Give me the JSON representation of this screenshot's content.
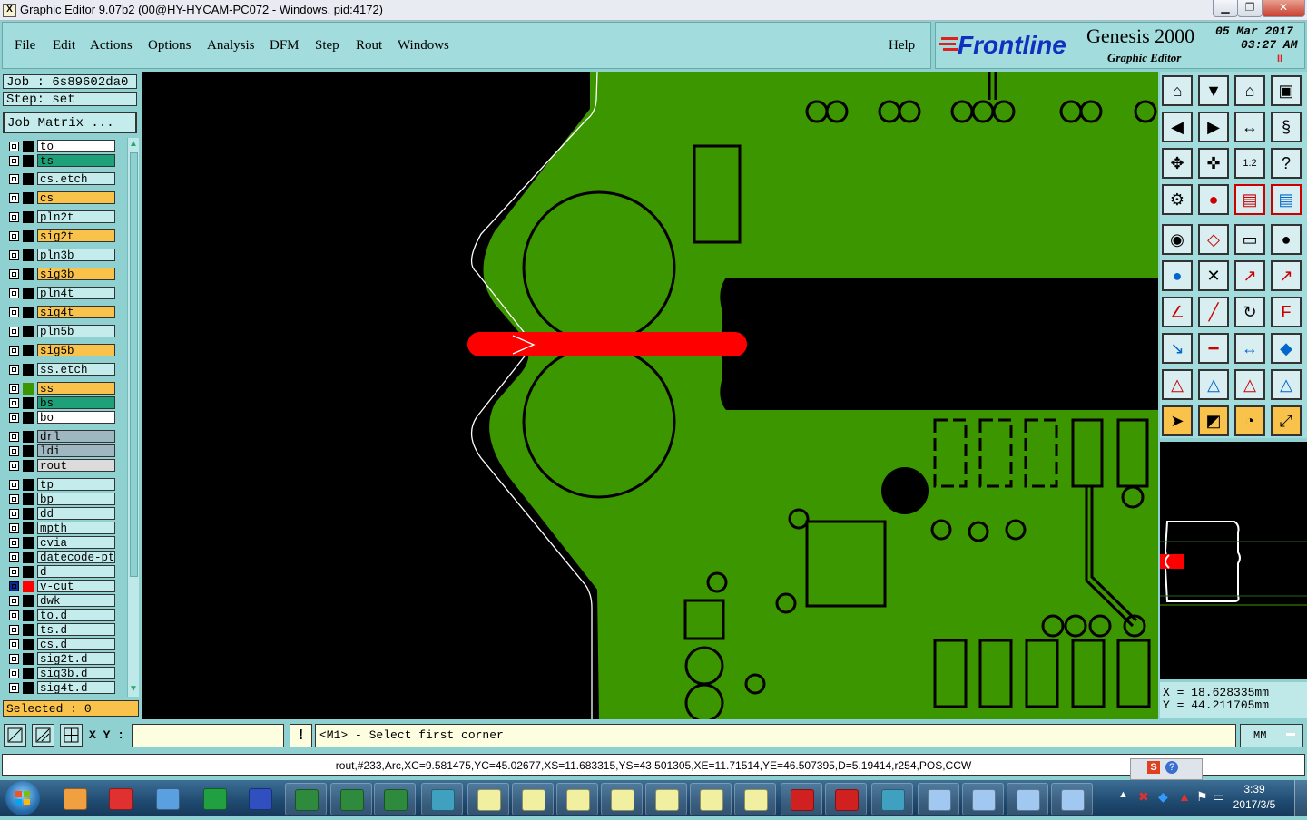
{
  "window": {
    "title": "Graphic Editor 9.07b2 (00@HY-HYCAM-PC072 - Windows, pid:4172)",
    "app_icon": "X"
  },
  "menu": [
    "File",
    "Edit",
    "Actions",
    "Options",
    "Analysis",
    "DFM",
    "Step",
    "Rout",
    "Windows"
  ],
  "help": "Help",
  "brand": {
    "logo": "Frontline",
    "product": "Genesis 2000",
    "subtitle": "Graphic Editor",
    "date": "05 Mar 2017",
    "time": "03:27 AM",
    "indicator": "II"
  },
  "job": {
    "job": "Job  : 6s89602da0",
    "step": "Step: set",
    "matrix": "Job Matrix ..."
  },
  "layers": [
    {
      "name": "to",
      "color": "#ffffff"
    },
    {
      "name": "ts",
      "color": "#1ea078"
    },
    {
      "name": "cs.etch",
      "color": "#c4ecec"
    },
    {
      "name": "cs",
      "color": "#f8c24b"
    },
    {
      "name": "pln2t",
      "color": "#c4ecec"
    },
    {
      "name": "sig2t",
      "color": "#f8c24b"
    },
    {
      "name": "pln3b",
      "color": "#c4ecec"
    },
    {
      "name": "sig3b",
      "color": "#f8c24b"
    },
    {
      "name": "pln4t",
      "color": "#c4ecec"
    },
    {
      "name": "sig4t",
      "color": "#f8c24b"
    },
    {
      "name": "pln5b",
      "color": "#c4ecec"
    },
    {
      "name": "sig5b",
      "color": "#f8c24b"
    },
    {
      "name": "ss.etch",
      "color": "#c4ecec"
    },
    {
      "name": "ss",
      "color": "#f8c24b"
    },
    {
      "name": "bs",
      "color": "#1ea078"
    },
    {
      "name": "bo",
      "color": "#ffffff"
    },
    {
      "name": "drl",
      "color": "#9fb7c0"
    },
    {
      "name": "ldi",
      "color": "#9fb7c0"
    },
    {
      "name": "rout",
      "color": "#dcdcdc"
    },
    {
      "name": "tp",
      "color": "#c4ecec"
    },
    {
      "name": "bp",
      "color": "#c4ecec"
    },
    {
      "name": "dd",
      "color": "#c4ecec"
    },
    {
      "name": "mpth",
      "color": "#c4ecec"
    },
    {
      "name": "cvia",
      "color": "#c4ecec"
    },
    {
      "name": "datecode-pt",
      "color": "#c4ecec"
    },
    {
      "name": "d",
      "color": "#c4ecec"
    },
    {
      "name": "v-cut",
      "color": "#c4ecec"
    },
    {
      "name": "dwk",
      "color": "#c4ecec"
    },
    {
      "name": "to.d",
      "color": "#c4ecec"
    },
    {
      "name": "ts.d",
      "color": "#c4ecec"
    },
    {
      "name": "cs.d",
      "color": "#c4ecec"
    },
    {
      "name": "sig2t.d",
      "color": "#c4ecec"
    },
    {
      "name": "sig3b.d",
      "color": "#c4ecec"
    },
    {
      "name": "sig4t.d",
      "color": "#c4ecec"
    }
  ],
  "selected": "Selected : 0",
  "coords": {
    "x": "X = 18.628335mm",
    "y": "Y = 44.211705mm"
  },
  "command": {
    "xy_label": "X Y :",
    "xy_value": "",
    "prompt": "<M1> - Select first corner",
    "units": "MM"
  },
  "status": "rout,#233,Arc,XC=9.581475,YC=45.02677,XS=11.683315,YS=43.501305,XE=11.71514,YE=46.507395,D=5.19414,r254,POS,CCW",
  "taskbar": {
    "time": "3:39",
    "date": "2017/3/5"
  },
  "colors": {
    "board": "#3c9600",
    "highlight": "#ff0000",
    "panel": "#8fd0d0",
    "accent": "#f8c24b"
  }
}
